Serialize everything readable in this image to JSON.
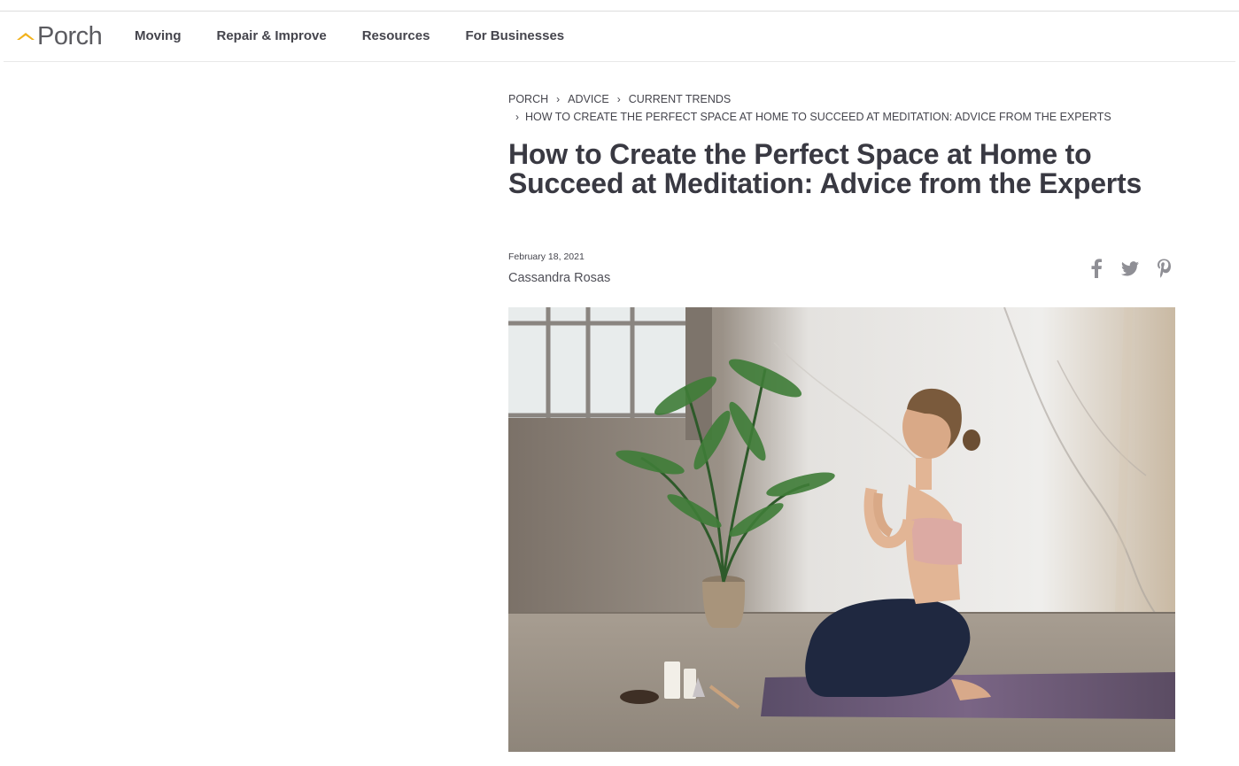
{
  "site": {
    "logo_text": "Porch",
    "logo_icon": "roof-icon",
    "brand_color": "#f2b21c"
  },
  "nav": {
    "items": [
      {
        "label": "Moving"
      },
      {
        "label": "Repair & Improve"
      },
      {
        "label": "Resources"
      },
      {
        "label": "For Businesses"
      }
    ]
  },
  "breadcrumb": {
    "items": [
      "PORCH",
      "ADVICE",
      "CURRENT TRENDS",
      "HOW TO CREATE THE PERFECT SPACE AT HOME TO SUCCEED AT MEDITATION: ADVICE FROM THE EXPERTS"
    ],
    "separator": "›"
  },
  "article": {
    "title": "How to Create the Perfect Space at Home to Succeed at Meditation: Advice from the Experts",
    "date": "February 18, 2021",
    "author": "Cassandra Rosas",
    "share_icons": [
      "facebook-icon",
      "twitter-icon",
      "pinterest-icon"
    ],
    "hero_image": "woman-meditating-photo"
  }
}
